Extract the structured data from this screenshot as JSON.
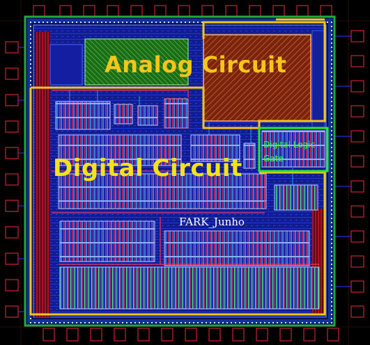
{
  "labels": {
    "analog": "Analog Circuit",
    "digital": "Digital Circuit",
    "logic_line1": "Digital Logic",
    "logic_line2": "Gate",
    "author": "FARK_Junho"
  },
  "colors": {
    "background": "#000000",
    "metal_blue": "#1a2ad8",
    "metal_red": "#c8102e",
    "green_outline": "#1faa3a",
    "highlight_yellow": "#f5c518",
    "logic_green": "#22ee22"
  }
}
